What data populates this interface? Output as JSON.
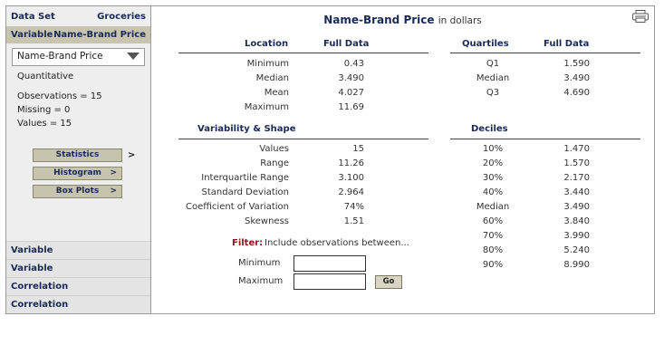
{
  "sidebar": {
    "dataset_label": "Data Set",
    "dataset_value": "Groceries",
    "variable_label": "Variable",
    "variable_value": "Name-Brand Price",
    "select_value": "Name-Brand Price",
    "type": "Quantitative",
    "observations": "Observations = 15",
    "missing": "Missing = 0",
    "values": "Values = 15",
    "buttons": [
      "Statistics",
      "Histogram",
      "Box Plots"
    ],
    "button_chevron": ">",
    "lower_items": [
      "Variable",
      "Variable",
      "Correlation",
      "Correlation"
    ]
  },
  "main": {
    "title": "Name-Brand Price",
    "title_unit": "in dollars",
    "location": {
      "header": "Location",
      "col_header": "Full Data",
      "rows": [
        {
          "label": "Minimum",
          "value": "0.43"
        },
        {
          "label": "Median",
          "value": "3.490"
        },
        {
          "label": "Mean",
          "value": "4.027"
        },
        {
          "label": "Maximum",
          "value": "11.69"
        }
      ]
    },
    "quartiles": {
      "header": "Quartiles",
      "col_header": "Full Data",
      "rows": [
        {
          "label": "Q1",
          "value": "1.590"
        },
        {
          "label": "Median",
          "value": "3.490"
        },
        {
          "label": "Q3",
          "value": "4.690"
        }
      ]
    },
    "variability": {
      "header": "Variability & Shape",
      "rows": [
        {
          "label": "Values",
          "value": "15"
        },
        {
          "label": "Range",
          "value": "11.26"
        },
        {
          "label": "Interquartile Range",
          "value": "3.100"
        },
        {
          "label": "Standard Deviation",
          "value": "2.964"
        },
        {
          "label": "Coefficient of Variation",
          "value": "74%"
        },
        {
          "label": "Skewness",
          "value": "1.51"
        }
      ]
    },
    "deciles": {
      "header": "Deciles",
      "rows": [
        {
          "label": "10%",
          "value": "1.470"
        },
        {
          "label": "20%",
          "value": "1.570"
        },
        {
          "label": "30%",
          "value": "2.170"
        },
        {
          "label": "40%",
          "value": "3.440"
        },
        {
          "label": "Median",
          "value": "3.490"
        },
        {
          "label": "60%",
          "value": "3.840"
        },
        {
          "label": "70%",
          "value": "3.990"
        },
        {
          "label": "80%",
          "value": "5.240"
        },
        {
          "label": "90%",
          "value": "8.990"
        }
      ]
    },
    "filter": {
      "label": "Filter:",
      "text": "Include observations between...",
      "min_label": "Minimum",
      "max_label": "Maximum",
      "min_value": "",
      "max_value": "",
      "go_label": "Go"
    }
  },
  "icons": {
    "print": "printer-icon",
    "dropdown": "chevron-down-icon"
  }
}
